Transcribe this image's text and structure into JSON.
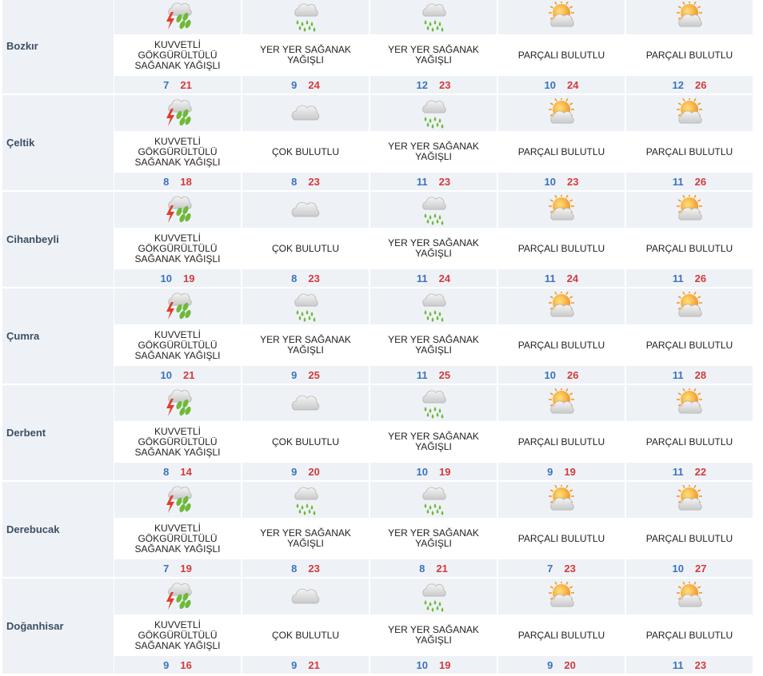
{
  "conditions": {
    "storm": "KUVVETLİ GÖKGÜRÜLTÜLÜ SAĞANAK YAĞIŞLI",
    "shower": "YER YER SAĞANAK YAĞIŞLI",
    "cloudy": "ÇOK BULUTLU",
    "partly": "PARÇALI BULUTLU"
  },
  "icon_names": {
    "storm": "thunderstorm-rain-icon",
    "shower": "rain-shower-icon",
    "cloudy": "cloudy-icon",
    "partly": "partly-cloudy-icon"
  },
  "colors": {
    "min_temp": "#3b73b9",
    "max_temp": "#d23b3b",
    "band": "#eef2f6",
    "location": "#3d4f63"
  },
  "rows": [
    {
      "location": "Bozkır",
      "days": [
        {
          "condition": "storm",
          "label": "KUVVETLİ GÖKGÜRÜLTÜLÜ SAĞANAK YAĞIŞLI",
          "min": "7",
          "max": "21"
        },
        {
          "condition": "shower",
          "label": "YER YER SAĞANAK YAĞIŞLI",
          "min": "9",
          "max": "24"
        },
        {
          "condition": "shower",
          "label": "YER YER SAĞANAK YAĞIŞLI",
          "min": "12",
          "max": "23"
        },
        {
          "condition": "partly",
          "label": "PARÇALI BULUTLU",
          "min": "10",
          "max": "24"
        },
        {
          "condition": "partly",
          "label": "PARÇALI BULUTLU",
          "min": "12",
          "max": "26"
        }
      ]
    },
    {
      "location": "Çeltik",
      "days": [
        {
          "condition": "storm",
          "label": "KUVVETLİ GÖKGÜRÜLTÜLÜ SAĞANAK YAĞIŞLI",
          "min": "8",
          "max": "18"
        },
        {
          "condition": "cloudy",
          "label": "ÇOK BULUTLU",
          "min": "8",
          "max": "23"
        },
        {
          "condition": "shower",
          "label": "YER YER SAĞANAK YAĞIŞLI",
          "min": "11",
          "max": "23"
        },
        {
          "condition": "partly",
          "label": "PARÇALI BULUTLU",
          "min": "10",
          "max": "23"
        },
        {
          "condition": "partly",
          "label": "PARÇALI BULUTLU",
          "min": "11",
          "max": "26"
        }
      ]
    },
    {
      "location": "Cihanbeyli",
      "days": [
        {
          "condition": "storm",
          "label": "KUVVETLİ GÖKGÜRÜLTÜLÜ SAĞANAK YAĞIŞLI",
          "min": "10",
          "max": "19"
        },
        {
          "condition": "cloudy",
          "label": "ÇOK BULUTLU",
          "min": "8",
          "max": "23"
        },
        {
          "condition": "shower",
          "label": "YER YER SAĞANAK YAĞIŞLI",
          "min": "11",
          "max": "24"
        },
        {
          "condition": "partly",
          "label": "PARÇALI BULUTLU",
          "min": "11",
          "max": "24"
        },
        {
          "condition": "partly",
          "label": "PARÇALI BULUTLU",
          "min": "11",
          "max": "26"
        }
      ]
    },
    {
      "location": "Çumra",
      "days": [
        {
          "condition": "storm",
          "label": "KUVVETLİ GÖKGÜRÜLTÜLÜ SAĞANAK YAĞIŞLI",
          "min": "10",
          "max": "21"
        },
        {
          "condition": "shower",
          "label": "YER YER SAĞANAK YAĞIŞLI",
          "min": "9",
          "max": "25"
        },
        {
          "condition": "shower",
          "label": "YER YER SAĞANAK YAĞIŞLI",
          "min": "11",
          "max": "25"
        },
        {
          "condition": "partly",
          "label": "PARÇALI BULUTLU",
          "min": "10",
          "max": "26"
        },
        {
          "condition": "partly",
          "label": "PARÇALI BULUTLU",
          "min": "11",
          "max": "28"
        }
      ]
    },
    {
      "location": "Derbent",
      "days": [
        {
          "condition": "storm",
          "label": "KUVVETLİ GÖKGÜRÜLTÜLÜ SAĞANAK YAĞIŞLI",
          "min": "8",
          "max": "14"
        },
        {
          "condition": "cloudy",
          "label": "ÇOK BULUTLU",
          "min": "9",
          "max": "20"
        },
        {
          "condition": "shower",
          "label": "YER YER SAĞANAK YAĞIŞLI",
          "min": "10",
          "max": "19"
        },
        {
          "condition": "partly",
          "label": "PARÇALI BULUTLU",
          "min": "9",
          "max": "19"
        },
        {
          "condition": "partly",
          "label": "PARÇALI BULUTLU",
          "min": "11",
          "max": "22"
        }
      ]
    },
    {
      "location": "Derebucak",
      "days": [
        {
          "condition": "storm",
          "label": "KUVVETLİ GÖKGÜRÜLTÜLÜ SAĞANAK YAĞIŞLI",
          "min": "7",
          "max": "19"
        },
        {
          "condition": "shower",
          "label": "YER YER SAĞANAK YAĞIŞLI",
          "min": "8",
          "max": "23"
        },
        {
          "condition": "shower",
          "label": "YER YER SAĞANAK YAĞIŞLI",
          "min": "8",
          "max": "21"
        },
        {
          "condition": "partly",
          "label": "PARÇALI BULUTLU",
          "min": "7",
          "max": "23"
        },
        {
          "condition": "partly",
          "label": "PARÇALI BULUTLU",
          "min": "10",
          "max": "27"
        }
      ]
    },
    {
      "location": "Doğanhisar",
      "days": [
        {
          "condition": "storm",
          "label": "KUVVETLİ GÖKGÜRÜLTÜLÜ SAĞANAK YAĞIŞLI",
          "min": "9",
          "max": "16"
        },
        {
          "condition": "cloudy",
          "label": "ÇOK BULUTLU",
          "min": "9",
          "max": "21"
        },
        {
          "condition": "shower",
          "label": "YER YER SAĞANAK YAĞIŞLI",
          "min": "10",
          "max": "19"
        },
        {
          "condition": "partly",
          "label": "PARÇALI BULUTLU",
          "min": "9",
          "max": "20"
        },
        {
          "condition": "partly",
          "label": "PARÇALI BULUTLU",
          "min": "11",
          "max": "23"
        }
      ]
    }
  ]
}
